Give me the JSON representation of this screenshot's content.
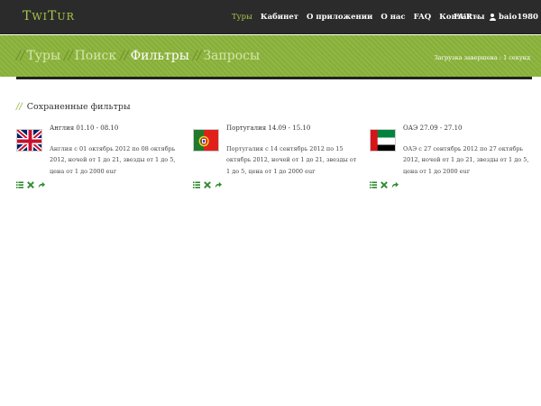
{
  "brand": {
    "name_first": "T",
    "name_rest": "WI",
    "name_second": "T",
    "name_tail": "UR"
  },
  "nav": {
    "links": [
      "Туры",
      "Кабинет",
      "О приложении",
      "О нас",
      "FAQ",
      "Контакты"
    ],
    "currency": "EUR",
    "username": "baio1980"
  },
  "breadcrumbs": {
    "items": [
      "Туры",
      "Поиск",
      "Фильтры",
      "Запросы"
    ],
    "current_index": 2,
    "separator": "//"
  },
  "status": "Загрузка завершена : 1 секунд",
  "section": {
    "title": "Сохраненные фильтры",
    "prefix": "//"
  },
  "filters": [
    {
      "title": "Англия 01.10 - 08.10",
      "description": "Англия с 01 октябрь 2012 по 08 октябрь 2012, ночей от 1 до 21, звезды от 1 до 5, цена от 1 до 2000 eur",
      "flag": "uk-flag-icon"
    },
    {
      "title": "Португалия 14.09 - 15.10",
      "description": "Португалия с 14 сентябрь 2012 по 15 октябрь 2012, ночей от 1 до 21, звезды от 1 до 5, цена от 1 до 2000 eur",
      "flag": "portugal-flag-icon"
    },
    {
      "title": "ОАЭ 27.09 - 27.10",
      "description": "ОАЭ с 27 сентябрь 2012 по 27 октябрь 2012, ночей от 1 до 21, звезды от 1 до 5, цена от 1 до 2000 eur",
      "flag": "uae-flag-icon"
    }
  ],
  "actions": [
    "list-icon",
    "delete-icon",
    "share-icon"
  ],
  "colors": {
    "accent": "#a6c84a",
    "band": "#8cb43c",
    "navbar": "#2b2b2b",
    "action": "#2f8a2f"
  }
}
